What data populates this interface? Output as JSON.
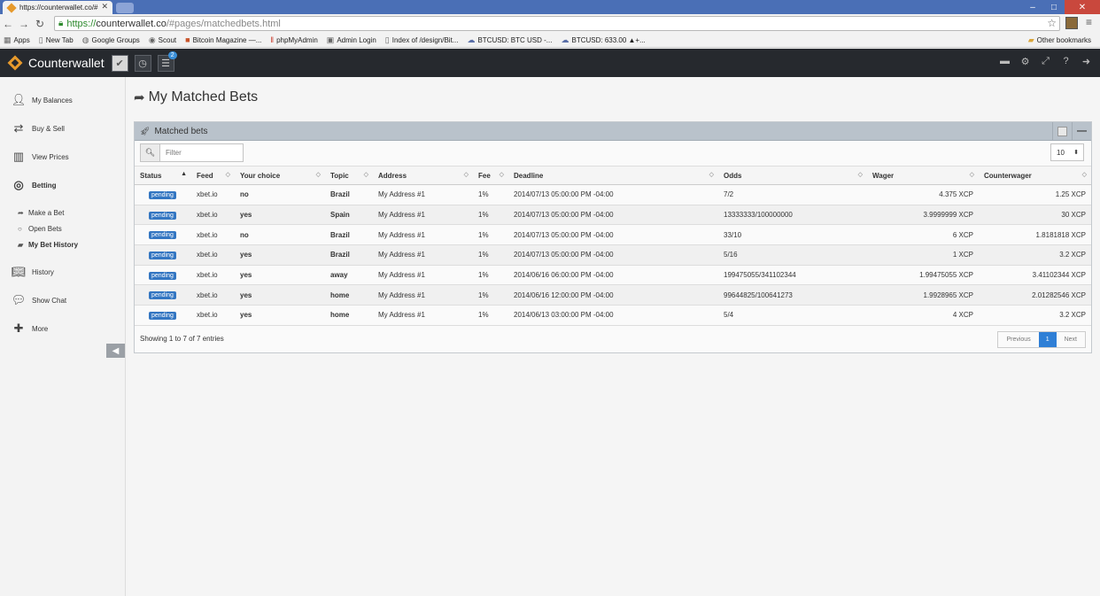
{
  "browser": {
    "tab_title": "https://counterwallet.co/#",
    "tab_close": "✕",
    "url_https": "https://",
    "url_domain": "counterwallet.co",
    "url_path": "/#pages/matchedbets.html"
  },
  "bookmarks": [
    {
      "label": "Apps",
      "icon": "apps-icon"
    },
    {
      "label": "New Tab",
      "icon": "page-icon"
    },
    {
      "label": "Google Groups",
      "icon": "google-groups-icon"
    },
    {
      "label": "Scout",
      "icon": "scout-icon"
    },
    {
      "label": "Bitcoin Magazine —...",
      "icon": "bitcoin-magazine-icon"
    },
    {
      "label": "phpMyAdmin",
      "icon": "phpmyadmin-icon"
    },
    {
      "label": "Admin Login",
      "icon": "admin-icon"
    },
    {
      "label": "Index of /design/Bit...",
      "icon": "page-icon"
    },
    {
      "label": "BTCUSD: BTC USD -...",
      "icon": "cloud-icon"
    },
    {
      "label": "BTCUSD: 633.00 ▲+...",
      "icon": "cloud-icon"
    }
  ],
  "other_bookmarks": "Other bookmarks",
  "app": {
    "brand": "Counterwallet",
    "notification_count": "2"
  },
  "sidebar": {
    "items": [
      {
        "label": "My Balances"
      },
      {
        "label": "Buy & Sell"
      },
      {
        "label": "View Prices"
      },
      {
        "label": "Betting"
      },
      {
        "label": "History"
      },
      {
        "label": "Show Chat"
      },
      {
        "label": "More"
      }
    ],
    "sub_items": [
      {
        "label": "Make a Bet"
      },
      {
        "label": "Open Bets"
      },
      {
        "label": "My Bet History"
      }
    ]
  },
  "page": {
    "title": "My Matched Bets"
  },
  "widget": {
    "title": "Matched bets",
    "filter_placeholder": "Filter",
    "page_size": "10",
    "columns": [
      "Status",
      "Feed",
      "Your choice",
      "Topic",
      "Address",
      "Fee",
      "Deadline",
      "Odds",
      "Wager",
      "Counterwager"
    ],
    "rows": [
      {
        "status": "pending",
        "feed": "xbet.io",
        "choice": "no",
        "topic": "Brazil",
        "address": "My Address #1",
        "fee": "1%",
        "deadline": "2014/07/13 05:00:00 PM -04:00",
        "odds": "7/2",
        "wager": "4.375 XCP",
        "counterwager": "1.25 XCP"
      },
      {
        "status": "pending",
        "feed": "xbet.io",
        "choice": "yes",
        "topic": "Spain",
        "address": "My Address #1",
        "fee": "1%",
        "deadline": "2014/07/13 05:00:00 PM -04:00",
        "odds": "13333333/100000000",
        "wager": "3.9999999 XCP",
        "counterwager": "30 XCP"
      },
      {
        "status": "pending",
        "feed": "xbet.io",
        "choice": "no",
        "topic": "Brazil",
        "address": "My Address #1",
        "fee": "1%",
        "deadline": "2014/07/13 05:00:00 PM -04:00",
        "odds": "33/10",
        "wager": "6 XCP",
        "counterwager": "1.8181818 XCP"
      },
      {
        "status": "pending",
        "feed": "xbet.io",
        "choice": "yes",
        "topic": "Brazil",
        "address": "My Address #1",
        "fee": "1%",
        "deadline": "2014/07/13 05:00:00 PM -04:00",
        "odds": "5/16",
        "wager": "1 XCP",
        "counterwager": "3.2 XCP"
      },
      {
        "status": "pending",
        "feed": "xbet.io",
        "choice": "yes",
        "topic": "away",
        "address": "My Address #1",
        "fee": "1%",
        "deadline": "2014/06/16 06:00:00 PM -04:00",
        "odds": "199475055/341102344",
        "wager": "1.99475055 XCP",
        "counterwager": "3.41102344 XCP"
      },
      {
        "status": "pending",
        "feed": "xbet.io",
        "choice": "yes",
        "topic": "home",
        "address": "My Address #1",
        "fee": "1%",
        "deadline": "2014/06/16 12:00:00 PM -04:00",
        "odds": "99644825/100641273",
        "wager": "1.9928965 XCP",
        "counterwager": "2.01282546 XCP"
      },
      {
        "status": "pending",
        "feed": "xbet.io",
        "choice": "yes",
        "topic": "home",
        "address": "My Address #1",
        "fee": "1%",
        "deadline": "2014/06/13 03:00:00 PM -04:00",
        "odds": "5/4",
        "wager": "4 XCP",
        "counterwager": "3.2 XCP"
      }
    ],
    "footer_info": "Showing 1 to 7 of 7 entries",
    "pager": {
      "previous": "Previous",
      "current": "1",
      "next": "Next"
    }
  },
  "colors": {
    "app_header": "#26292e",
    "accent_blue": "#3376c2",
    "logo_orange": "#e99b2c"
  }
}
